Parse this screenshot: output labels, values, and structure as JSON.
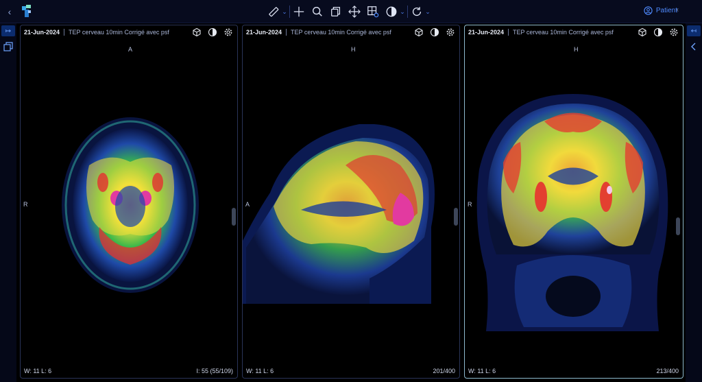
{
  "toolbar": {
    "tools": [
      "ruler-icon",
      "crosshair-icon",
      "zoom-icon",
      "stack-icon",
      "pan-icon",
      "layout-icon",
      "contrast-icon",
      "rotate-icon"
    ],
    "patient_label": "Patient"
  },
  "colors": {
    "topbar_bg": "#070b1e",
    "accent": "#4f8bff",
    "active_border": "#8fbcd0"
  },
  "viewports": [
    {
      "date": "21-Jun-2024",
      "series": "TEP cerveau 10min Corrigé avec psf",
      "orient_top": "A",
      "orient_left": "R",
      "window": "W: 11  L: 6",
      "index": "I: 55 (55/109)"
    },
    {
      "date": "21-Jun-2024",
      "series": "TEP cerveau 10min Corrigé avec psf",
      "orient_top": "H",
      "orient_left": "A",
      "window": "W: 11  L: 6",
      "index": "201/400"
    },
    {
      "date": "21-Jun-2024",
      "series": "TEP cerveau 10min Corrigé avec psf",
      "orient_top": "H",
      "orient_left": "R",
      "window": "W: 11  L: 6",
      "index": "213/400"
    }
  ]
}
